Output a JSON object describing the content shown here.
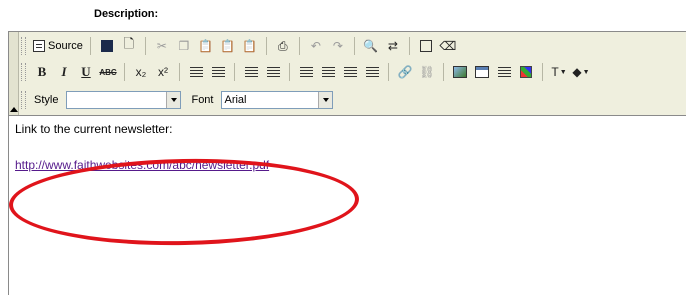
{
  "field": {
    "label": "Description:"
  },
  "toolbar": {
    "source_label": "Source",
    "style_label": "Style",
    "style_value": "",
    "font_label": "Font",
    "font_value": "Arial"
  },
  "content": {
    "text": "Link to the current newsletter:",
    "link": "http://www.faithwebsites.com/abc/newsletter.pdf"
  },
  "colors": {
    "toolbar_bg": "#efefde",
    "link": "#551a8b",
    "annotation_oval": "#e0141b"
  }
}
